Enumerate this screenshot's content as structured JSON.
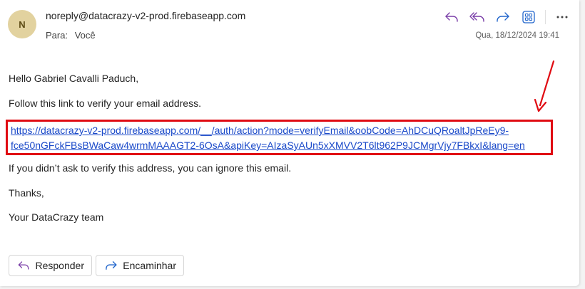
{
  "header": {
    "avatar_initial": "N",
    "sender": "noreply@datacrazy-v2-prod.firebaseapp.com",
    "to_label": "Para:",
    "to_value": "Você",
    "date": "Qua, 18/12/2024 19:41"
  },
  "toolbar": {
    "icons": [
      "reply-icon",
      "reply-all-icon",
      "forward-icon",
      "apps-icon",
      "more-icon"
    ],
    "more_label": "···"
  },
  "message": {
    "greeting": "Hello Gabriel Cavalli Paduch,",
    "instruction": "Follow this link to verify your email address.",
    "link_line1": "https://datacrazy-v2-prod.firebaseapp.com/__/auth/action?mode=verifyEmail&oobCode=AhDCuQRoaltJpReEy9-",
    "link_line2": "fce50nGFckFBsBWaCaw4wrmMAAAGT2-6OsA&apiKey=AIzaSyAUn5xXMVV2T6lt962P9JCMgrVjy7FBkxI&lang=en",
    "ignore_note": "If you didn’t ask to verify this address, you can ignore this email.",
    "thanks": "Thanks,",
    "signature": "Your DataCrazy team"
  },
  "footer": {
    "reply_label": "Responder",
    "forward_label": "Encaminhar"
  },
  "colors": {
    "accent": "#7a3ea8",
    "forward_accent": "#2266cc",
    "link": "#1a49c9",
    "highlight_box": "#e00b12",
    "avatar_bg": "#e2d29f"
  }
}
